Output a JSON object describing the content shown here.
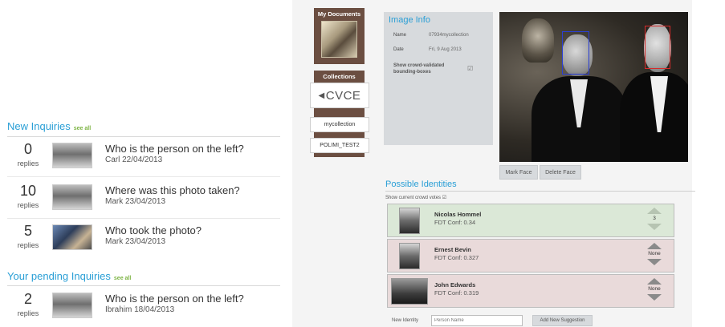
{
  "left": {
    "new_inquiries": {
      "title": "New Inquiries",
      "see_all": "see all",
      "items": [
        {
          "count": "0",
          "replies_label": "replies",
          "question": "Who is the person on the left?",
          "byline": "Carl 22/04/2013"
        },
        {
          "count": "10",
          "replies_label": "replies",
          "question": "Where was this photo taken?",
          "byline": "Mark 23/04/2013"
        },
        {
          "count": "5",
          "replies_label": "replies",
          "question": "Who took the photo?",
          "byline": "Mark 23/04/2013"
        }
      ]
    },
    "pending_inquiries": {
      "title": "Your pending Inquiries",
      "see_all": "see all",
      "items": [
        {
          "count": "2",
          "replies_label": "replies",
          "question": "Who is the person on the left?",
          "byline": "Ibrahim 18/04/2013"
        }
      ]
    }
  },
  "sidebar": {
    "my_documents": "My Documents",
    "collections": "Collections",
    "collection_logo": "CVCE",
    "collection_items": [
      "mycollection",
      "POLIMI_TEST2"
    ]
  },
  "image_info": {
    "title": "Image Info",
    "name_label": "Name",
    "name_value": "07934mycollection",
    "date_label": "Date",
    "date_value": "Fri, 9 Aug 2013",
    "show_boxes_label_1": "Show crowd-validated",
    "show_boxes_label_2": "bounding-boxes",
    "show_boxes_checked": "☑"
  },
  "face_buttons": {
    "mark": "Mark Face",
    "delete": "Delete Face"
  },
  "possible_identities": {
    "title": "Possible Identities",
    "show_votes": "Show current crowd votes ☑",
    "items": [
      {
        "name": "Nicolas Hommel",
        "conf": "FDT Conf: 0.34",
        "votes": "3",
        "status": "green"
      },
      {
        "name": "Ernest Bevin",
        "conf": "FDT Conf: 0.327",
        "votes": "None",
        "status": "red"
      },
      {
        "name": "John Edwards",
        "conf": "FDT Conf: 0.319",
        "votes": "None",
        "status": "red"
      }
    ]
  },
  "new_identity": {
    "label": "New Identity",
    "placeholder": "Person Name",
    "button": "Add New Suggestion"
  },
  "colors": {
    "accent_blue": "#2a9fd6",
    "see_all_green": "#7cb342",
    "sidebar_brown": "#6b4e41",
    "box_blue": "#2a3fd6",
    "box_red": "#d62a2a"
  }
}
